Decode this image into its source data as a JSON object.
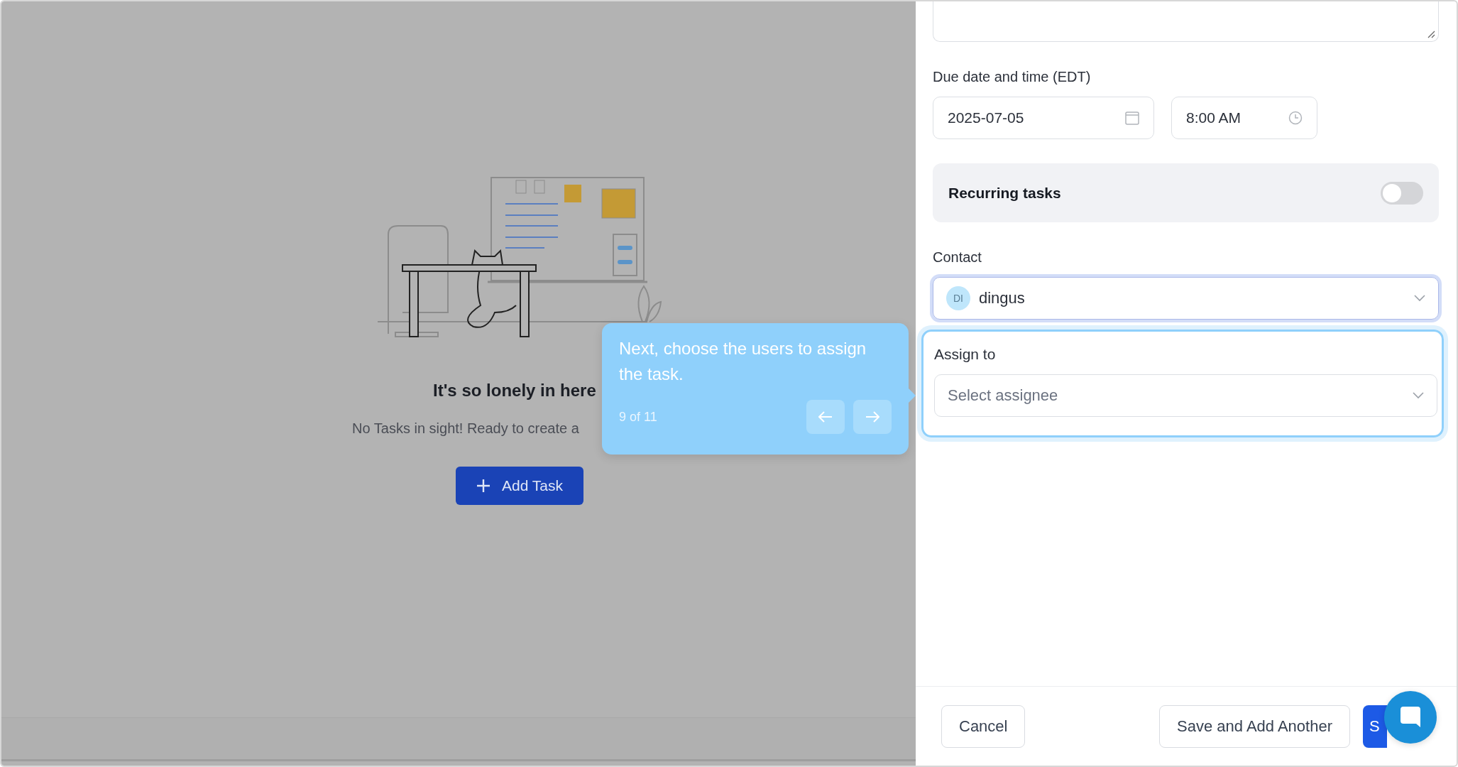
{
  "empty_state": {
    "title": "It's so lonely in here",
    "message": "No Tasks in sight! Ready to create a",
    "button": {
      "label": "Add Task"
    }
  },
  "tour_tooltip": {
    "message": "Next, choose the users to assign the task.",
    "step": "9 of 11"
  },
  "form": {
    "due_label": "Due date and time (EDT)",
    "date": "2025-07-05",
    "time": "8:00 AM",
    "recurring": {
      "label": "Recurring tasks",
      "on": false
    },
    "contact": {
      "label": "Contact",
      "initials": "DI",
      "value": "dingus"
    },
    "assign": {
      "label": "Assign to",
      "placeholder": "Select assignee"
    }
  },
  "footer_buttons": [
    {
      "label": "Cancel",
      "kind": "outline"
    },
    {
      "label": "Save and Add Another",
      "kind": "outline"
    },
    {
      "label": "S",
      "kind": "primary"
    }
  ]
}
